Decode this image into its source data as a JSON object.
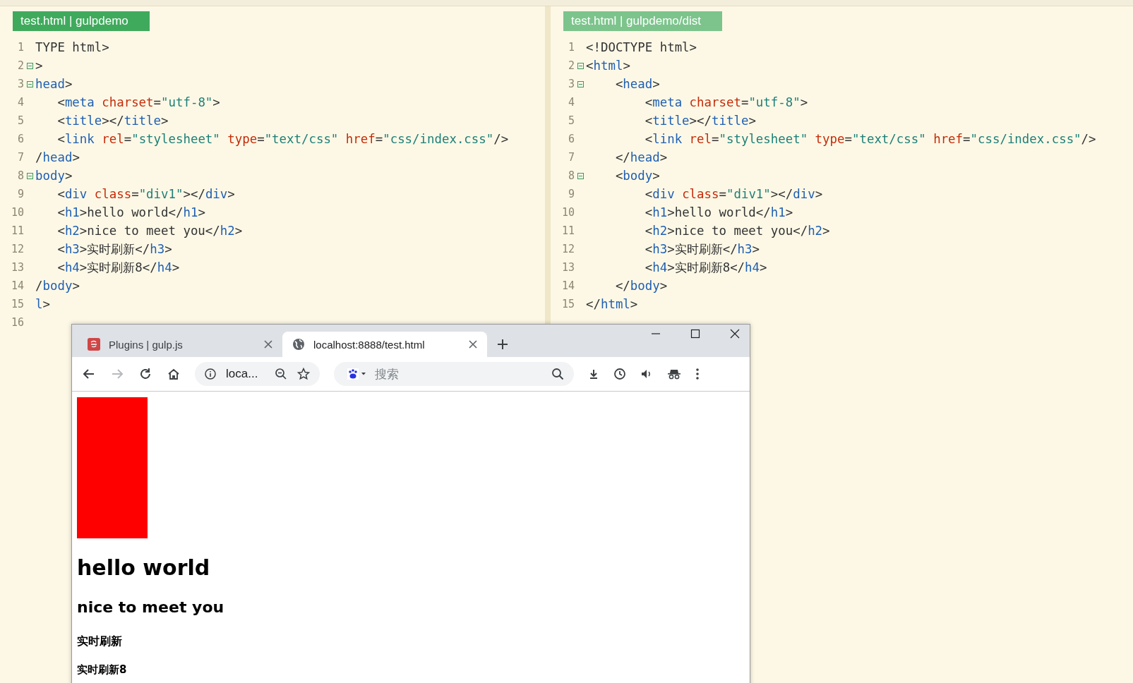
{
  "editors": [
    {
      "tab": "test.html | gulpdemo",
      "selected": true,
      "lines": [
        {
          "number": "1",
          "fold": false,
          "tokens": [
            {
              "kind": "plain",
              "text": "TYPE html>"
            }
          ]
        },
        {
          "number": "2",
          "fold": true,
          "tokens": [
            {
              "kind": "plain",
              "text": ">"
            }
          ]
        },
        {
          "number": "3",
          "fold": true,
          "tokens": [
            {
              "kind": "tag",
              "text": "head"
            },
            {
              "kind": "plain",
              "text": ">"
            }
          ]
        },
        {
          "number": "4",
          "fold": false,
          "tokens": [
            {
              "kind": "plain",
              "text": "   <"
            },
            {
              "kind": "tag",
              "text": "meta"
            },
            {
              "kind": "attr",
              "text": " charset"
            },
            {
              "kind": "plain",
              "text": "="
            },
            {
              "kind": "str",
              "text": "\"utf-8\""
            },
            {
              "kind": "plain",
              "text": ">"
            }
          ]
        },
        {
          "number": "5",
          "fold": false,
          "tokens": [
            {
              "kind": "plain",
              "text": "   <"
            },
            {
              "kind": "tag",
              "text": "title"
            },
            {
              "kind": "plain",
              "text": "></"
            },
            {
              "kind": "tag",
              "text": "title"
            },
            {
              "kind": "plain",
              "text": ">"
            }
          ]
        },
        {
          "number": "6",
          "fold": false,
          "tokens": [
            {
              "kind": "plain",
              "text": "   <"
            },
            {
              "kind": "tag",
              "text": "link"
            },
            {
              "kind": "attr",
              "text": " rel"
            },
            {
              "kind": "plain",
              "text": "="
            },
            {
              "kind": "str",
              "text": "\"stylesheet\""
            },
            {
              "kind": "attr",
              "text": " type"
            },
            {
              "kind": "plain",
              "text": "="
            },
            {
              "kind": "str",
              "text": "\"text/css\""
            },
            {
              "kind": "attr",
              "text": " href"
            },
            {
              "kind": "plain",
              "text": "="
            },
            {
              "kind": "str",
              "text": "\"css/index.css\""
            },
            {
              "kind": "plain",
              "text": "/>"
            }
          ]
        },
        {
          "number": "7",
          "fold": false,
          "tokens": [
            {
              "kind": "plain",
              "text": "/"
            },
            {
              "kind": "tag",
              "text": "head"
            },
            {
              "kind": "plain",
              "text": ">"
            }
          ]
        },
        {
          "number": "8",
          "fold": true,
          "tokens": [
            {
              "kind": "tag",
              "text": "body"
            },
            {
              "kind": "plain",
              "text": ">"
            }
          ]
        },
        {
          "number": "9",
          "fold": false,
          "tokens": [
            {
              "kind": "plain",
              "text": "   <"
            },
            {
              "kind": "tag",
              "text": "div"
            },
            {
              "kind": "attr",
              "text": " class"
            },
            {
              "kind": "plain",
              "text": "="
            },
            {
              "kind": "str",
              "text": "\"div1\""
            },
            {
              "kind": "plain",
              "text": "></"
            },
            {
              "kind": "tag",
              "text": "div"
            },
            {
              "kind": "plain",
              "text": ">"
            }
          ]
        },
        {
          "number": "10",
          "fold": false,
          "tokens": [
            {
              "kind": "plain",
              "text": "   <"
            },
            {
              "kind": "tag",
              "text": "h1"
            },
            {
              "kind": "plain",
              "text": ">hello world</"
            },
            {
              "kind": "tag",
              "text": "h1"
            },
            {
              "kind": "plain",
              "text": ">"
            }
          ]
        },
        {
          "number": "11",
          "fold": false,
          "tokens": [
            {
              "kind": "plain",
              "text": "   <"
            },
            {
              "kind": "tag",
              "text": "h2"
            },
            {
              "kind": "plain",
              "text": ">nice to meet you</"
            },
            {
              "kind": "tag",
              "text": "h2"
            },
            {
              "kind": "plain",
              "text": ">"
            }
          ]
        },
        {
          "number": "12",
          "fold": false,
          "tokens": [
            {
              "kind": "plain",
              "text": "   <"
            },
            {
              "kind": "tag",
              "text": "h3"
            },
            {
              "kind": "plain",
              "text": ">实时刷新</"
            },
            {
              "kind": "tag",
              "text": "h3"
            },
            {
              "kind": "plain",
              "text": ">"
            }
          ]
        },
        {
          "number": "13",
          "fold": false,
          "tokens": [
            {
              "kind": "plain",
              "text": "   <"
            },
            {
              "kind": "tag",
              "text": "h4"
            },
            {
              "kind": "plain",
              "text": ">实时刷新8</"
            },
            {
              "kind": "tag",
              "text": "h4"
            },
            {
              "kind": "plain",
              "text": ">"
            }
          ]
        },
        {
          "number": "14",
          "fold": false,
          "tokens": [
            {
              "kind": "plain",
              "text": "/"
            },
            {
              "kind": "tag",
              "text": "body"
            },
            {
              "kind": "plain",
              "text": ">"
            }
          ]
        },
        {
          "number": "15",
          "fold": false,
          "tokens": [
            {
              "kind": "tag",
              "text": "l"
            },
            {
              "kind": "plain",
              "text": ">"
            }
          ]
        },
        {
          "number": "16",
          "fold": false
        }
      ]
    },
    {
      "tab": "test.html | gulpdemo/dist",
      "selected": false,
      "lines": [
        {
          "number": "1",
          "fold": false,
          "tokens": [
            {
              "kind": "plain",
              "text": "<!DOCTYPE html>"
            }
          ]
        },
        {
          "number": "2",
          "fold": true,
          "tokens": [
            {
              "kind": "plain",
              "text": "<"
            },
            {
              "kind": "tag",
              "text": "html"
            },
            {
              "kind": "plain",
              "text": ">"
            }
          ]
        },
        {
          "number": "3",
          "fold": true,
          "tokens": [
            {
              "kind": "plain",
              "text": "    <"
            },
            {
              "kind": "tag",
              "text": "head"
            },
            {
              "kind": "plain",
              "text": ">"
            }
          ]
        },
        {
          "number": "4",
          "fold": false,
          "tokens": [
            {
              "kind": "plain",
              "text": "        <"
            },
            {
              "kind": "tag",
              "text": "meta"
            },
            {
              "kind": "attr",
              "text": " charset"
            },
            {
              "kind": "plain",
              "text": "="
            },
            {
              "kind": "str",
              "text": "\"utf-8\""
            },
            {
              "kind": "plain",
              "text": ">"
            }
          ]
        },
        {
          "number": "5",
          "fold": false,
          "tokens": [
            {
              "kind": "plain",
              "text": "        <"
            },
            {
              "kind": "tag",
              "text": "title"
            },
            {
              "kind": "plain",
              "text": "></"
            },
            {
              "kind": "tag",
              "text": "title"
            },
            {
              "kind": "plain",
              "text": ">"
            }
          ]
        },
        {
          "number": "6",
          "fold": false,
          "tokens": [
            {
              "kind": "plain",
              "text": "        <"
            },
            {
              "kind": "tag",
              "text": "link"
            },
            {
              "kind": "attr",
              "text": " rel"
            },
            {
              "kind": "plain",
              "text": "="
            },
            {
              "kind": "str",
              "text": "\"stylesheet\""
            },
            {
              "kind": "attr",
              "text": " type"
            },
            {
              "kind": "plain",
              "text": "="
            },
            {
              "kind": "str",
              "text": "\"text/css\""
            },
            {
              "kind": "attr",
              "text": " href"
            },
            {
              "kind": "plain",
              "text": "="
            },
            {
              "kind": "str",
              "text": "\"css/index.css\""
            },
            {
              "kind": "plain",
              "text": "/>"
            }
          ]
        },
        {
          "number": "7",
          "fold": false,
          "tokens": [
            {
              "kind": "plain",
              "text": "    </"
            },
            {
              "kind": "tag",
              "text": "head"
            },
            {
              "kind": "plain",
              "text": ">"
            }
          ]
        },
        {
          "number": "8",
          "fold": true,
          "tokens": [
            {
              "kind": "plain",
              "text": "    <"
            },
            {
              "kind": "tag",
              "text": "body"
            },
            {
              "kind": "plain",
              "text": ">"
            }
          ]
        },
        {
          "number": "9",
          "fold": false,
          "tokens": [
            {
              "kind": "plain",
              "text": "        <"
            },
            {
              "kind": "tag",
              "text": "div"
            },
            {
              "kind": "attr",
              "text": " class"
            },
            {
              "kind": "plain",
              "text": "="
            },
            {
              "kind": "str",
              "text": "\"div1\""
            },
            {
              "kind": "plain",
              "text": "></"
            },
            {
              "kind": "tag",
              "text": "div"
            },
            {
              "kind": "plain",
              "text": ">"
            }
          ]
        },
        {
          "number": "10",
          "fold": false,
          "tokens": [
            {
              "kind": "plain",
              "text": "        <"
            },
            {
              "kind": "tag",
              "text": "h1"
            },
            {
              "kind": "plain",
              "text": ">hello world</"
            },
            {
              "kind": "tag",
              "text": "h1"
            },
            {
              "kind": "plain",
              "text": ">"
            }
          ]
        },
        {
          "number": "11",
          "fold": false,
          "tokens": [
            {
              "kind": "plain",
              "text": "        <"
            },
            {
              "kind": "tag",
              "text": "h2"
            },
            {
              "kind": "plain",
              "text": ">nice to meet you</"
            },
            {
              "kind": "tag",
              "text": "h2"
            },
            {
              "kind": "plain",
              "text": ">"
            }
          ]
        },
        {
          "number": "12",
          "fold": false,
          "tokens": [
            {
              "kind": "plain",
              "text": "        <"
            },
            {
              "kind": "tag",
              "text": "h3"
            },
            {
              "kind": "plain",
              "text": ">实时刷新</"
            },
            {
              "kind": "tag",
              "text": "h3"
            },
            {
              "kind": "plain",
              "text": ">"
            }
          ]
        },
        {
          "number": "13",
          "fold": false,
          "tokens": [
            {
              "kind": "plain",
              "text": "        <"
            },
            {
              "kind": "tag",
              "text": "h4"
            },
            {
              "kind": "plain",
              "text": ">实时刷新8</"
            },
            {
              "kind": "tag",
              "text": "h4"
            },
            {
              "kind": "plain",
              "text": ">"
            }
          ]
        },
        {
          "number": "14",
          "fold": false,
          "tokens": [
            {
              "kind": "plain",
              "text": "    </"
            },
            {
              "kind": "tag",
              "text": "body"
            },
            {
              "kind": "plain",
              "text": ">"
            }
          ]
        },
        {
          "number": "15",
          "fold": false,
          "tokens": [
            {
              "kind": "plain",
              "text": "</"
            },
            {
              "kind": "tag",
              "text": "html"
            },
            {
              "kind": "plain",
              "text": ">"
            }
          ]
        }
      ]
    }
  ],
  "browser": {
    "tabs": [
      {
        "title": "Plugins | gulp.js",
        "kind": "gulp",
        "selected": false
      },
      {
        "title": "localhost:8888/test.html",
        "kind": "globe",
        "selected": true
      }
    ],
    "nav_buttons": [
      {
        "kind": "back",
        "disabled": false
      },
      {
        "kind": "forward",
        "disabled": true
      },
      {
        "kind": "reload",
        "disabled": false
      },
      {
        "kind": "home",
        "disabled": false
      }
    ],
    "address": "loca...",
    "search": {
      "placeholder": "搜索"
    },
    "page": {
      "headings": [
        {
          "kind": "h1",
          "text": "hello world"
        },
        {
          "kind": "h2",
          "text": "nice to meet you"
        },
        {
          "kind": "h3",
          "text": "实时刷新"
        },
        {
          "kind": "h4",
          "text": "实时刷新8"
        }
      ]
    }
  }
}
